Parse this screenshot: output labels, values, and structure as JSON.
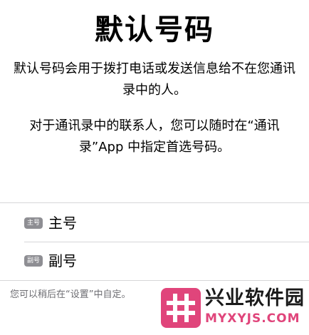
{
  "header": {
    "title": "默认号码"
  },
  "description": {
    "paragraph1": "默认号码会用于拨打电话或发送信息给不在您通讯录中的人。",
    "paragraph2": "对于通讯录中的联系人，您可以随时在“通讯录”App 中指定首选号码。"
  },
  "lines": [
    {
      "badge": "主号",
      "label": "主号"
    },
    {
      "badge": "副号",
      "label": "副号"
    }
  ],
  "footnote": "您可以稍后在“设置”中自定。",
  "watermark": {
    "name": "兴业软件园",
    "url": "MYXYJS.COM",
    "logo_icon": "hash-icon"
  },
  "colors": {
    "badge_gray": "#8e8e93",
    "separator": "#d6d6d8",
    "footnote_gray": "#6d6d72",
    "watermark_pink": "#e0457b"
  }
}
